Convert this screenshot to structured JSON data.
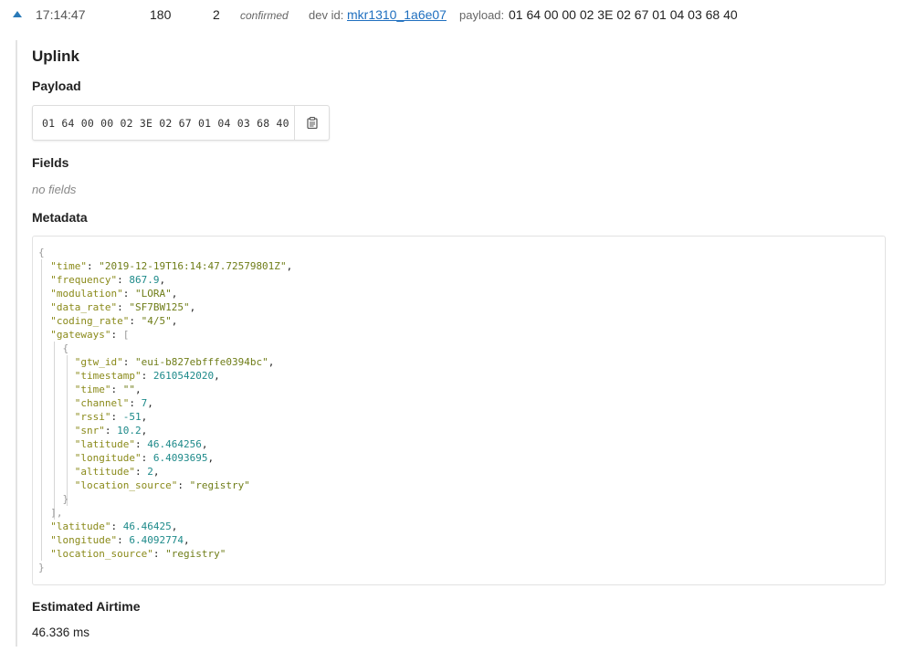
{
  "row": {
    "time": "17:14:47",
    "counter": "180",
    "port": "2",
    "status": "confirmed",
    "dev_id_label": "dev id:",
    "dev_id": "mkr1310_1a6e07",
    "payload_label": "payload:",
    "payload": "01 64 00 00 02 3E 02 67 01 04 03 68 40"
  },
  "detail": {
    "title": "Uplink",
    "payload_heading": "Payload",
    "payload_hex": "01 64 00 00 02 3E 02 67 01 04 03 68 40",
    "fields_heading": "Fields",
    "no_fields": "no fields",
    "metadata_heading": "Metadata",
    "airtime_heading": "Estimated Airtime",
    "airtime_value": "46.336 ms"
  },
  "metadata": {
    "time": "2019-12-19T16:14:47.72579801Z",
    "frequency": "867.9",
    "modulation": "LORA",
    "data_rate": "SF7BW125",
    "coding_rate": "4/5",
    "gateway": {
      "gtw_id": "eui-b827ebfffe0394bc",
      "timestamp": "2610542020",
      "time": "",
      "channel": "7",
      "rssi": "-51",
      "snr": "10.2",
      "latitude": "46.464256",
      "longitude": "6.4093695",
      "altitude": "2",
      "location_source": "registry"
    },
    "latitude": "46.46425",
    "longitude": "6.4092774",
    "location_source": "registry"
  },
  "icons": {
    "collapse": "caret-up-icon",
    "copy": "clipboard-icon"
  },
  "colors": {
    "link": "#1f6fbf",
    "json_key": "#8a8a1a",
    "json_string": "#6f7d18",
    "json_number": "#1e8a8a"
  }
}
